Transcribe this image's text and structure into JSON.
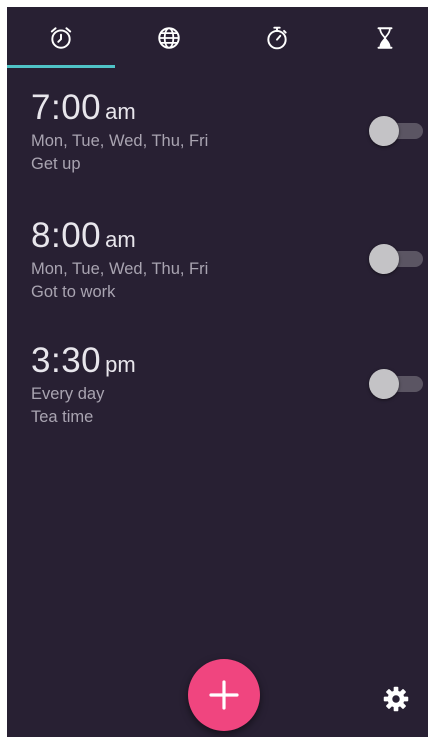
{
  "tabs": [
    {
      "icon": "alarm-clock-icon",
      "selected": true
    },
    {
      "icon": "globe-icon",
      "selected": false
    },
    {
      "icon": "stopwatch-icon",
      "selected": false
    },
    {
      "icon": "hourglass-icon",
      "selected": false
    }
  ],
  "alarms": [
    {
      "time": "7:00",
      "period": "am",
      "days": "Mon, Tue, Wed, Thu, Fri",
      "label": "Get up",
      "enabled": false
    },
    {
      "time": "8:00",
      "period": "am",
      "days": "Mon, Tue, Wed, Thu, Fri",
      "label": "Got to work",
      "enabled": false
    },
    {
      "time": "3:30",
      "period": "pm",
      "days": "Every day",
      "label": "Tea time",
      "enabled": false
    }
  ],
  "fab": {
    "icon": "plus-icon"
  },
  "settings": {
    "icon": "gear-icon"
  },
  "colors": {
    "background": "#282033",
    "accent": "#4fc3c7",
    "fab": "#f0457f",
    "primary_text": "#e8e6ec",
    "secondary_text": "#a9a4b1"
  }
}
